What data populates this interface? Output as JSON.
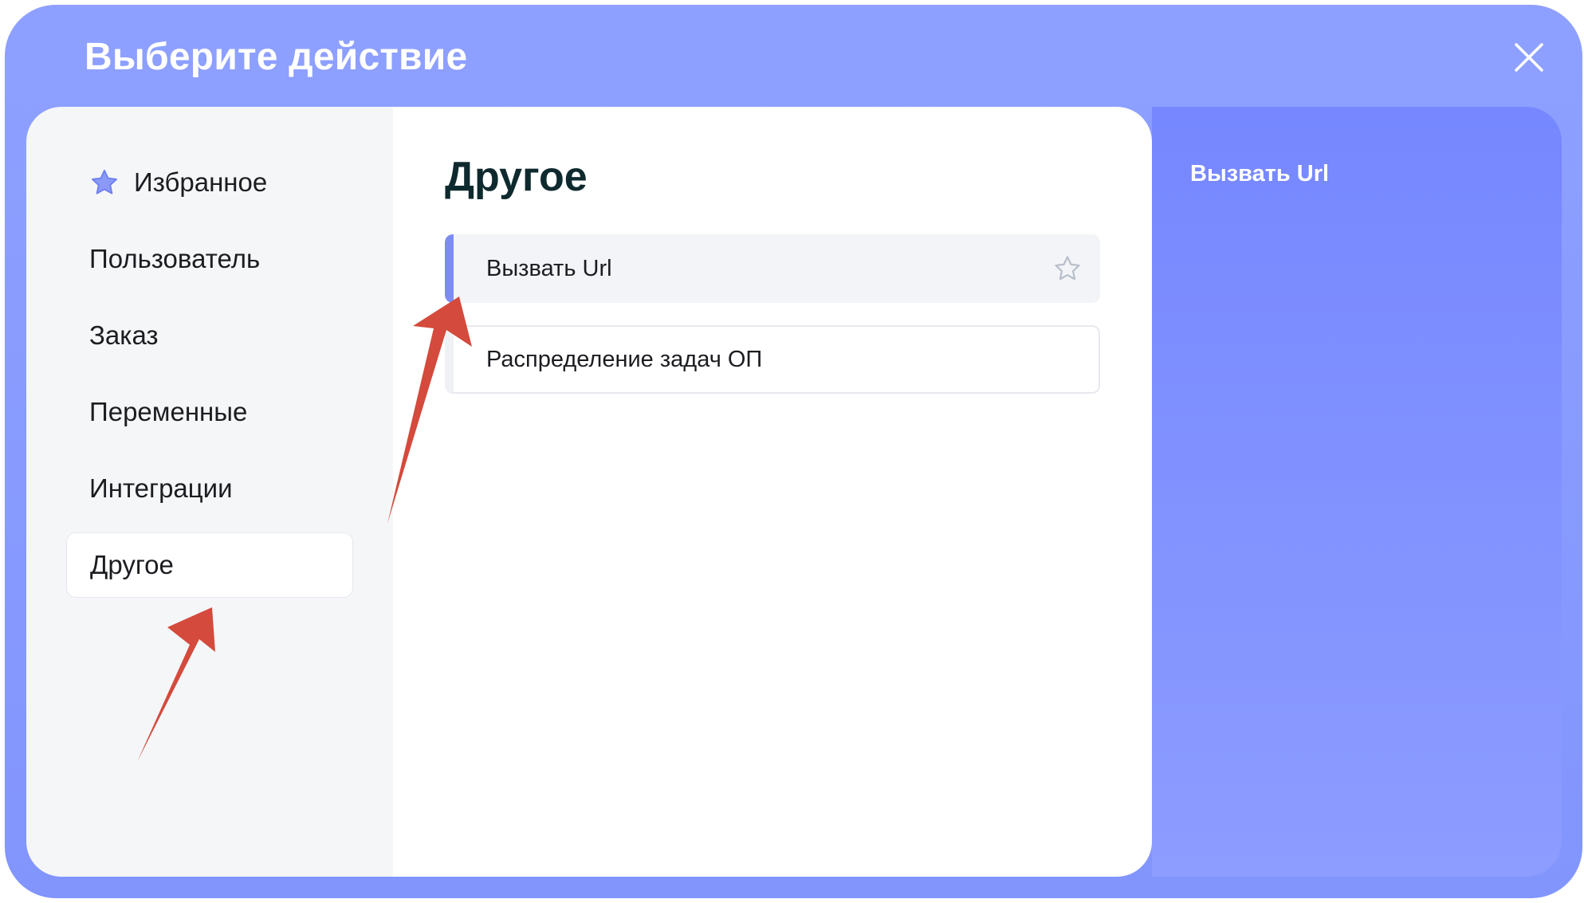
{
  "dialog": {
    "title": "Выберите действие",
    "close_icon": "close-icon"
  },
  "sidebar": {
    "items": [
      {
        "label": "Избранное",
        "icon": "star-icon"
      },
      {
        "label": "Пользователь"
      },
      {
        "label": "Заказ"
      },
      {
        "label": "Переменные"
      },
      {
        "label": "Интеграции"
      },
      {
        "label": "Другое",
        "active": true
      }
    ]
  },
  "main": {
    "title": "Другое",
    "actions": [
      {
        "label": "Вызвать Url",
        "selected": true,
        "icon": "star-outline-icon"
      },
      {
        "label": "Распределение задач ОП"
      }
    ]
  },
  "preview": {
    "title": "Вызвать Url"
  },
  "colors": {
    "accent": "#7d8cf5",
    "header_bg": "#8ea0ff",
    "preview_bg": "#7687ff",
    "annotation_arrow": "#d44a3c"
  }
}
